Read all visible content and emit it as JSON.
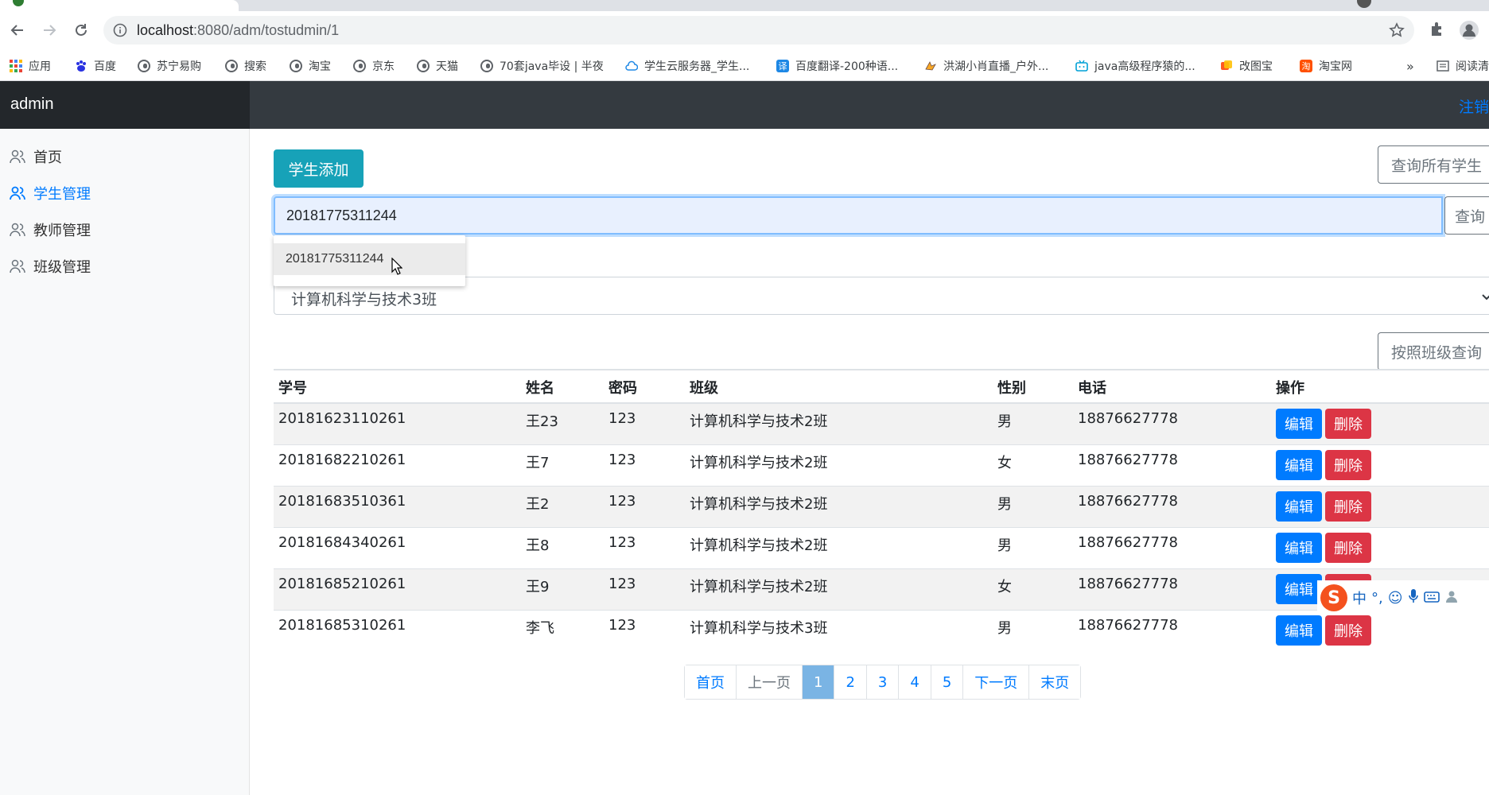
{
  "browser": {
    "url_host": "localhost",
    "url_path": ":8080/adm/tostudmin/1"
  },
  "bookmarks": [
    {
      "label": "应用",
      "icon": "apps-grid-icon"
    },
    {
      "label": "百度",
      "icon": "baidu-paw-icon"
    },
    {
      "label": "苏宁易购",
      "icon": "globe-icon"
    },
    {
      "label": "搜索",
      "icon": "globe-icon"
    },
    {
      "label": "淘宝",
      "icon": "globe-icon"
    },
    {
      "label": "京东",
      "icon": "globe-icon"
    },
    {
      "label": "天猫",
      "icon": "globe-icon"
    },
    {
      "label": "70套java毕设 | 半夜",
      "icon": "globe-icon"
    },
    {
      "label": "学生云服务器_学生...",
      "icon": "cloud-icon"
    },
    {
      "label": "百度翻译-200种语...",
      "icon": "translate-icon"
    },
    {
      "label": "洪湖小肖直播_户外...",
      "icon": "bird-icon"
    },
    {
      "label": "java高级程序猿的...",
      "icon": "bilibili-icon"
    },
    {
      "label": "改图宝",
      "icon": "image-edit-icon"
    },
    {
      "label": "淘宝网",
      "icon": "taobao-icon"
    },
    {
      "label": "»",
      "icon": ""
    },
    {
      "label": "阅读清单",
      "icon": "reading-list-icon"
    }
  ],
  "app": {
    "brand": "admin",
    "signout": "注销"
  },
  "sidebar": {
    "items": [
      {
        "label": "首页",
        "active": false
      },
      {
        "label": "学生管理",
        "active": true
      },
      {
        "label": "教师管理",
        "active": false
      },
      {
        "label": "班级管理",
        "active": false
      }
    ]
  },
  "main": {
    "add_button": "学生添加",
    "query_all_button": "查询所有学生",
    "search_value": "20181775311244",
    "search_button": "查询",
    "autocomplete_option": "20181775311244",
    "class_select_value": "计算机科学与技术3班",
    "query_by_class_button": "按照班级查询"
  },
  "table": {
    "headers": [
      "学号",
      "姓名",
      "密码",
      "班级",
      "性别",
      "电话",
      "操作"
    ],
    "rows": [
      [
        "20181623110261",
        "王23",
        "123",
        "计算机科学与技术2班",
        "男",
        "18876627778"
      ],
      [
        "20181682210261",
        "王7",
        "123",
        "计算机科学与技术2班",
        "女",
        "18876627778"
      ],
      [
        "20181683510361",
        "王2",
        "123",
        "计算机科学与技术2班",
        "男",
        "18876627778"
      ],
      [
        "20181684340261",
        "王8",
        "123",
        "计算机科学与技术2班",
        "男",
        "18876627778"
      ],
      [
        "20181685210261",
        "王9",
        "123",
        "计算机科学与技术2班",
        "女",
        "18876627778"
      ],
      [
        "20181685310261",
        "李飞",
        "123",
        "计算机科学与技术3班",
        "男",
        "18876627778"
      ]
    ],
    "edit_label": "编辑",
    "delete_label": "删除"
  },
  "pagination": {
    "items": [
      "首页",
      "上一页",
      "1",
      "2",
      "3",
      "4",
      "5",
      "下一页",
      "末页"
    ],
    "active": "1"
  },
  "ime": {
    "logo": "S",
    "mode": "中"
  },
  "colors": {
    "appbar": "#343a40",
    "brand_bg": "#23272b",
    "primary": "#007bff",
    "info": "#17a2b8",
    "danger": "#dc3545"
  }
}
